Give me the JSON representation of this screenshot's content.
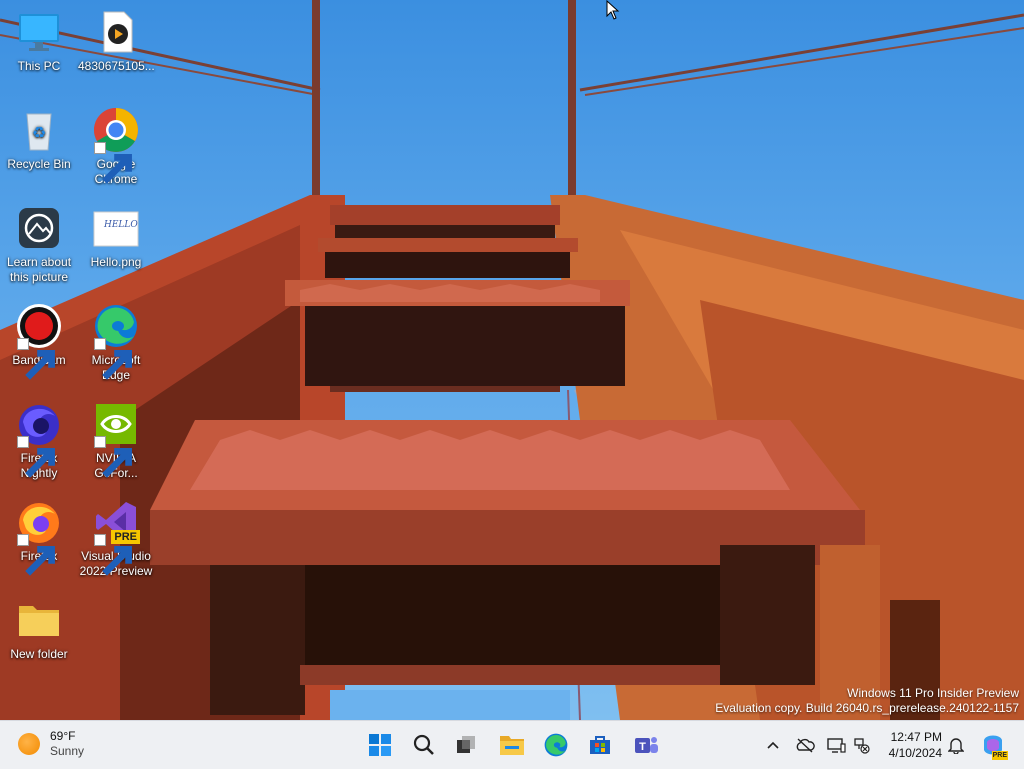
{
  "desktop": {
    "icons": [
      {
        "name": "this-pc",
        "label": "This PC"
      },
      {
        "name": "video-file",
        "label": "4830675105..."
      },
      {
        "name": "recycle-bin",
        "label": "Recycle Bin"
      },
      {
        "name": "google-chrome",
        "label": "Google Chrome"
      },
      {
        "name": "learn-about-picture",
        "label": "Learn about this picture"
      },
      {
        "name": "hello-png",
        "label": "Hello.png"
      },
      {
        "name": "bandicam",
        "label": "Bandicam"
      },
      {
        "name": "microsoft-edge",
        "label": "Microsoft Edge"
      },
      {
        "name": "firefox-nightly",
        "label": "Firefox Nightly"
      },
      {
        "name": "nvidia-geforce",
        "label": "NVIDIA GeFor..."
      },
      {
        "name": "firefox",
        "label": "Firefox"
      },
      {
        "name": "visual-studio",
        "label": "Visual Studio 2022 Preview"
      },
      {
        "name": "new-folder",
        "label": "New folder"
      }
    ],
    "hello_png_text": "HELLO",
    "vs_badge": "PRE"
  },
  "watermark": {
    "line1": "Windows 11 Pro Insider Preview",
    "line2": "Evaluation copy. Build 26040.rs_prerelease.240122-1157"
  },
  "taskbar": {
    "weather": {
      "temp": "69°F",
      "condition": "Sunny"
    },
    "apps": [
      "start-icon",
      "search-icon",
      "task-view-icon",
      "file-explorer-icon",
      "edge-icon",
      "store-icon",
      "teams-icon"
    ],
    "tray": [
      "chevron-up-icon",
      "onedrive-offline-icon",
      "display-icon",
      "network-disconnected-icon",
      "bell-icon",
      "copilot-icon"
    ],
    "copilot_badge": "PRE",
    "clock": {
      "time": "12:47 PM",
      "date": "4/10/2024"
    }
  },
  "colors": {
    "sky": "#5aa6ea",
    "tower": "#c0502e",
    "tower_dark": "#3a1a12",
    "taskbar": "#eef0f3"
  }
}
